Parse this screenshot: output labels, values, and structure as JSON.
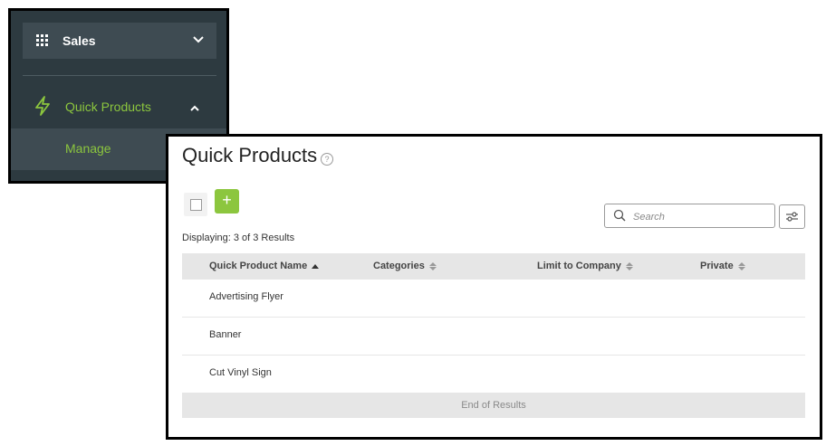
{
  "sidebar": {
    "sales_label": "Sales",
    "quick_products_label": "Quick Products",
    "manage_label": "Manage"
  },
  "page": {
    "title": "Quick Products",
    "help_glyph": "?",
    "add_label": "+",
    "search_placeholder": "Search",
    "displaying_text": "Displaying: 3 of 3 Results",
    "end_text": "End of Results"
  },
  "table": {
    "columns": [
      "Quick Product Name",
      "Categories",
      "Limit to Company",
      "Private"
    ],
    "rows": [
      "Advertising Flyer",
      "Banner",
      "Cut Vinyl Sign"
    ]
  },
  "colors": {
    "accent": "#8cc63e",
    "sidebar_bg": "#2d3a40",
    "sidebar_item_bg": "#3e4b52"
  },
  "icons": [
    "grid-icon",
    "chevron-down-icon",
    "bolt-icon",
    "chevron-up-icon",
    "help-icon",
    "search-icon",
    "filter-icon"
  ]
}
